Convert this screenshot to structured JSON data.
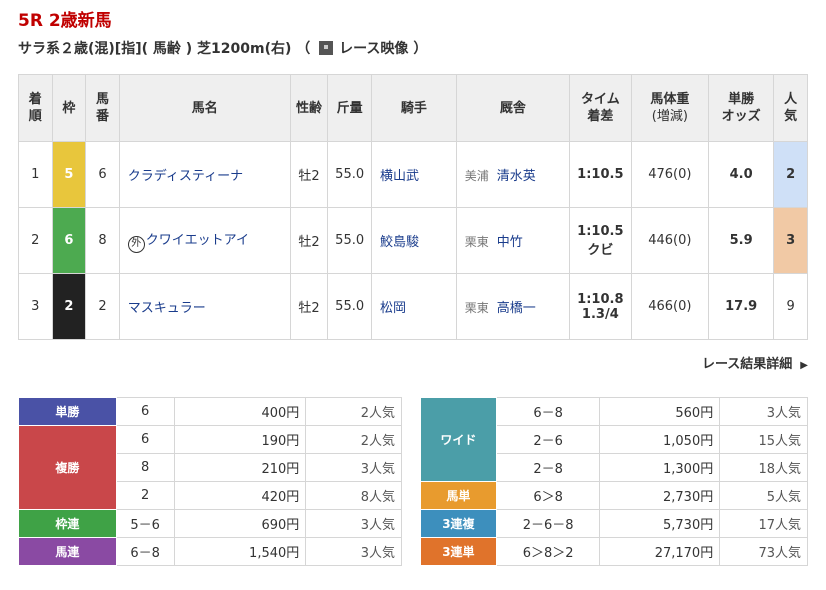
{
  "race": {
    "title": "5R 2歳新馬",
    "conditions": "サラ系２歳(混)[指]( 馬齢 ) 芝1200m(右) （",
    "video_label": "レース映像",
    "conditions_end": "）"
  },
  "headers": {
    "rank": "着順",
    "waku": "枠",
    "umaban": "馬番",
    "name": "馬名",
    "sexage": "性齢",
    "weight": "斤量",
    "jockey": "騎手",
    "trainer": "厩舎",
    "time": "タイム着差",
    "body": "馬体重(増減)",
    "odds": "単勝オッズ",
    "pop": "人気"
  },
  "results": [
    {
      "rank": "1",
      "waku": "5",
      "umaban": "6",
      "prefix": "",
      "name": "クラディスティーナ",
      "sexage": "牡2",
      "weight": "55.0",
      "jockey": "横山武",
      "loc": "美浦",
      "trainer": "清水英",
      "time": "1:10.5",
      "margin": "",
      "body": "476(0)",
      "odds": "4.0",
      "pop": "2"
    },
    {
      "rank": "2",
      "waku": "6",
      "umaban": "8",
      "prefix": "外",
      "name": "クワイエットアイ",
      "sexage": "牡2",
      "weight": "55.0",
      "jockey": "鮫島駿",
      "loc": "栗東",
      "trainer": "中竹",
      "time": "1:10.5",
      "margin": "クビ",
      "body": "446(0)",
      "odds": "5.9",
      "pop": "3"
    },
    {
      "rank": "3",
      "waku": "2",
      "umaban": "2",
      "prefix": "",
      "name": "マスキュラー",
      "sexage": "牡2",
      "weight": "55.0",
      "jockey": "松岡",
      "loc": "栗東",
      "trainer": "高橋一",
      "time": "1:10.8",
      "margin": "1.3/4",
      "body": "466(0)",
      "odds": "17.9",
      "pop": "9"
    }
  ],
  "more_link": "レース結果詳細",
  "colors": {
    "waku5": "#e8c63c",
    "waku6": "#4daa50",
    "waku2": "#222222",
    "pop1": "#cfe0f7",
    "pop2": "#f1c9a5",
    "tansho": "#4a52a6",
    "fukusho": "#c9474a",
    "wakuren": "#3fa246",
    "umaren": "#8a4aa3",
    "wide": "#4b9ea8",
    "umatan": "#e89b2e",
    "sanrenpuku": "#3d8fbd",
    "sanrentan": "#e0732b"
  },
  "payouts_left": {
    "tansho": {
      "label": "単勝",
      "rows": [
        {
          "num": "6",
          "amt": "400円",
          "pop": "2人気"
        }
      ]
    },
    "fukusho": {
      "label": "複勝",
      "rows": [
        {
          "num": "6",
          "amt": "190円",
          "pop": "2人気"
        },
        {
          "num": "8",
          "amt": "210円",
          "pop": "3人気"
        },
        {
          "num": "2",
          "amt": "420円",
          "pop": "8人気"
        }
      ]
    },
    "wakuren": {
      "label": "枠連",
      "rows": [
        {
          "num": "5－6",
          "amt": "690円",
          "pop": "3人気"
        }
      ]
    },
    "umaren": {
      "label": "馬連",
      "rows": [
        {
          "num": "6－8",
          "amt": "1,540円",
          "pop": "3人気"
        }
      ]
    }
  },
  "payouts_right": {
    "wide": {
      "label": "ワイド",
      "rows": [
        {
          "num": "6－8",
          "amt": "560円",
          "pop": "3人気"
        },
        {
          "num": "2－6",
          "amt": "1,050円",
          "pop": "15人気"
        },
        {
          "num": "2－8",
          "amt": "1,300円",
          "pop": "18人気"
        }
      ]
    },
    "umatan": {
      "label": "馬単",
      "rows": [
        {
          "num": "6＞8",
          "amt": "2,730円",
          "pop": "5人気"
        }
      ]
    },
    "sanrenpuku": {
      "label": "3連複",
      "rows": [
        {
          "num": "2－6－8",
          "amt": "5,730円",
          "pop": "17人気"
        }
      ]
    },
    "sanrentan": {
      "label": "3連単",
      "rows": [
        {
          "num": "6＞8＞2",
          "amt": "27,170円",
          "pop": "73人気"
        }
      ]
    }
  }
}
